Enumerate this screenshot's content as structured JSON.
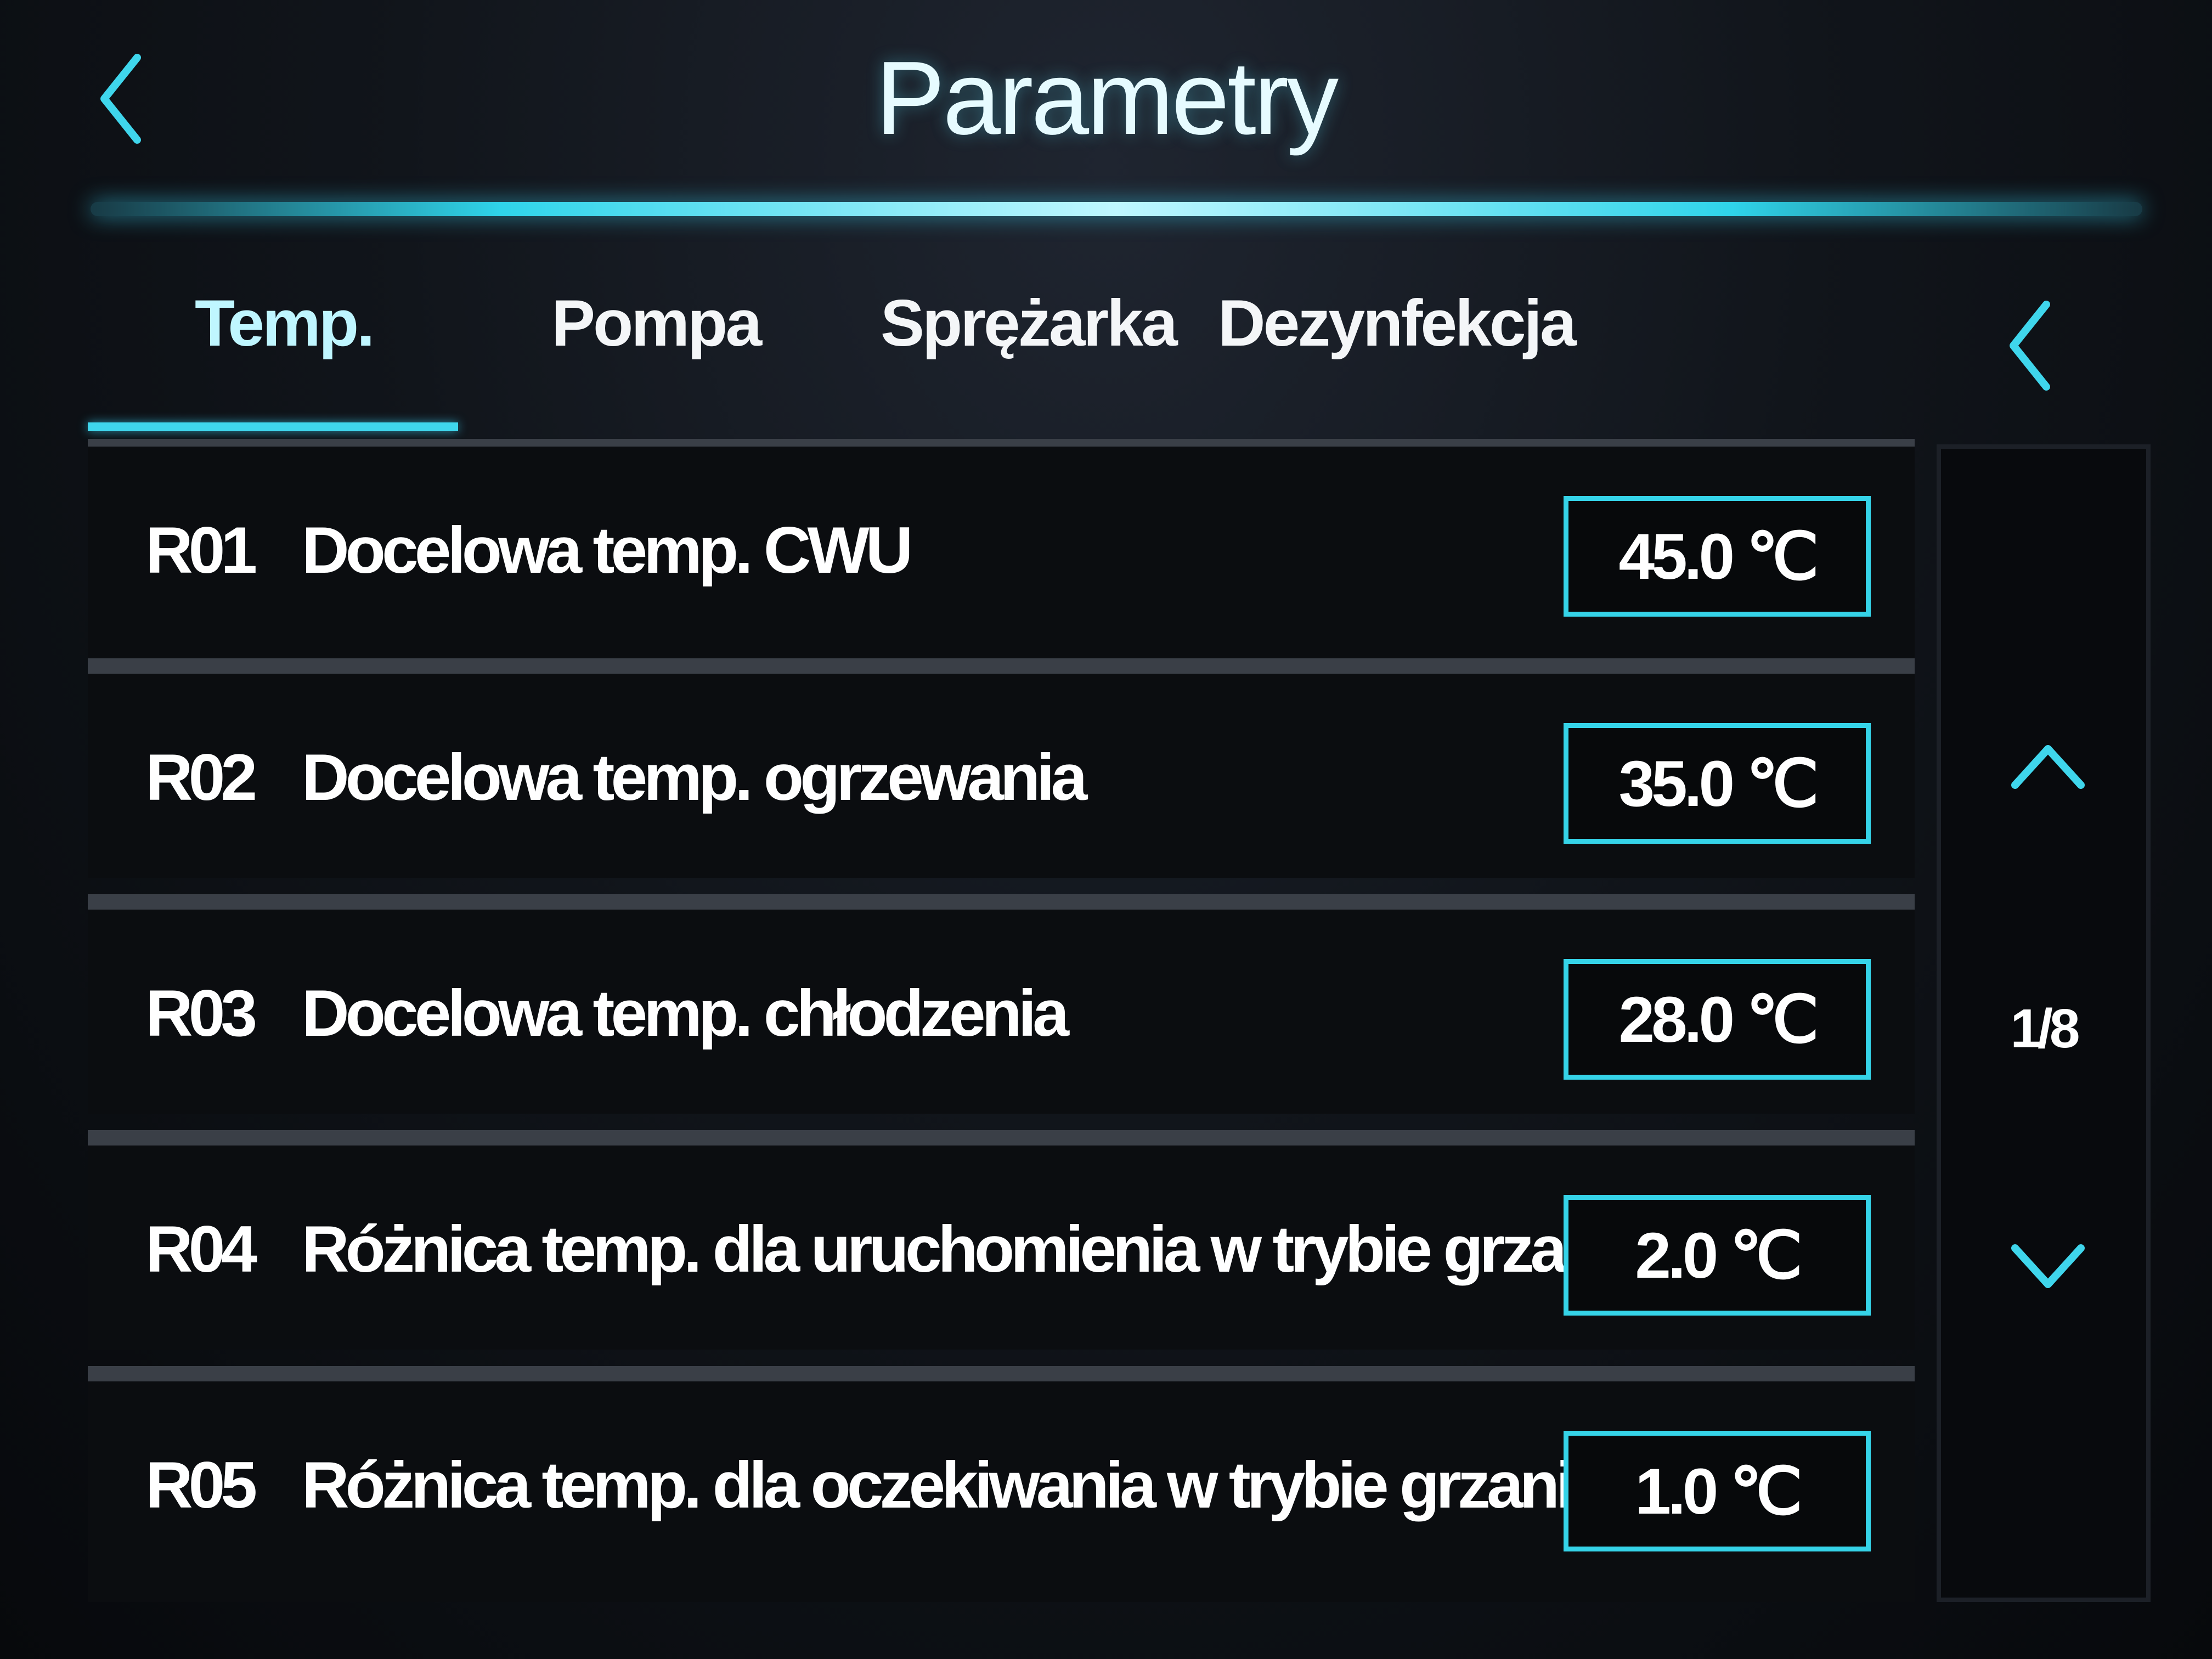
{
  "header": {
    "title": "Parametry",
    "back_icon": "chevron-left-icon",
    "accent_color": "#35d3e8"
  },
  "tabs": {
    "items": [
      {
        "label": "Temp.",
        "active": true
      },
      {
        "label": "Pompa",
        "active": false
      },
      {
        "label": "Sprężarka",
        "active": false
      },
      {
        "label": "Dezynfekcja",
        "active": false
      }
    ],
    "scroll_icon": "chevron-left-icon"
  },
  "rows": [
    {
      "code": "R01",
      "label": "Docelowa temp. CWU",
      "value": "45.0 ℃"
    },
    {
      "code": "R02",
      "label": "Docelowa temp. ogrzewania",
      "value": "35.0 ℃"
    },
    {
      "code": "R03",
      "label": "Docelowa temp. chłodzenia",
      "value": "28.0 ℃"
    },
    {
      "code": "R04",
      "label": "Różnica temp. dla uruchomienia w trybie grzania",
      "value": "2.0 ℃"
    },
    {
      "code": "R05",
      "label": "Różnica temp. dla oczekiwania w trybie grzania",
      "value": "1.0 ℃"
    }
  ],
  "pager": {
    "page_text": "1/8",
    "up_icon": "chevron-up-icon",
    "down_icon": "chevron-down-icon"
  }
}
